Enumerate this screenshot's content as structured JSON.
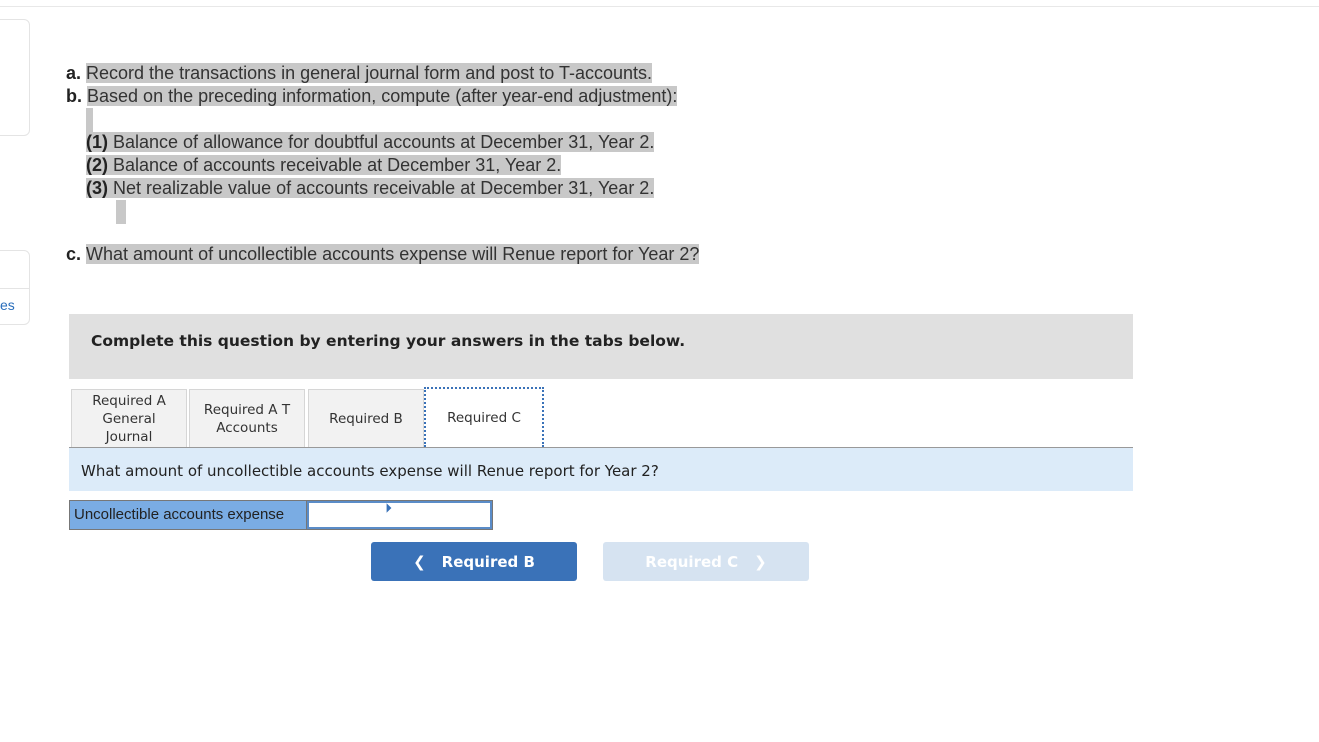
{
  "sidebar": {
    "partial_label": "es"
  },
  "questions": {
    "a": {
      "letter": "a.",
      "text": "Record the transactions in general journal form and post to T-accounts."
    },
    "b": {
      "letter": "b.",
      "text": "Based on the preceding information, compute (after year-end adjustment):"
    },
    "b_items": [
      {
        "num": "(1)",
        "text": " Balance of allowance for doubtful accounts at December 31, Year 2."
      },
      {
        "num": "(2)",
        "text": " Balance of accounts receivable at December 31, Year 2."
      },
      {
        "num": "(3)",
        "text": " Net realizable value of accounts receivable at December 31, Year 2."
      }
    ],
    "c": {
      "letter": "c.",
      "text": "What amount of uncollectible accounts expense will Renue report for Year 2?"
    }
  },
  "banner": "Complete this question by entering your answers in the tabs below.",
  "tabs": [
    {
      "label": "Required A\nGeneral\nJournal"
    },
    {
      "label": "Required A T\nAccounts"
    },
    {
      "label": "Required B"
    },
    {
      "label": "Required C",
      "active": true
    }
  ],
  "prompt": "What amount of uncollectible accounts expense will Renue report for Year 2?",
  "answer": {
    "label": "Uncollectible accounts expense",
    "value": ""
  },
  "nav": {
    "prev_label": "Required B",
    "next_label": "Required C",
    "prev_icon": "chevron-left-icon",
    "next_icon": "chevron-right-icon"
  },
  "colors": {
    "accent": "#3a72b8",
    "prompt_bg": "#dcebf9",
    "label_bg": "#7aace3"
  }
}
